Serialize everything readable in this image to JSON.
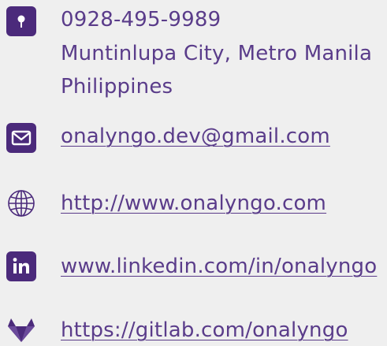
{
  "contact": {
    "phone": "0928-495-9989",
    "city": "Muntinlupa City, Metro Manila",
    "country": "Philippines",
    "email": "onalyngo.dev@gmail.com",
    "website": "http://www.onalyngo.com",
    "linkedin": "www.linkedin.com/in/onalyngo",
    "gitlab": "https://gitlab.com/onalyngo"
  },
  "icons": {
    "location": "map-pin-icon",
    "email": "envelope-icon",
    "website": "globe-icon",
    "linkedin": "linkedin-icon",
    "gitlab": "gitlab-icon"
  },
  "colors": {
    "accent": "#4b2a7b",
    "text": "#5a3c8a",
    "background": "#efefef"
  }
}
